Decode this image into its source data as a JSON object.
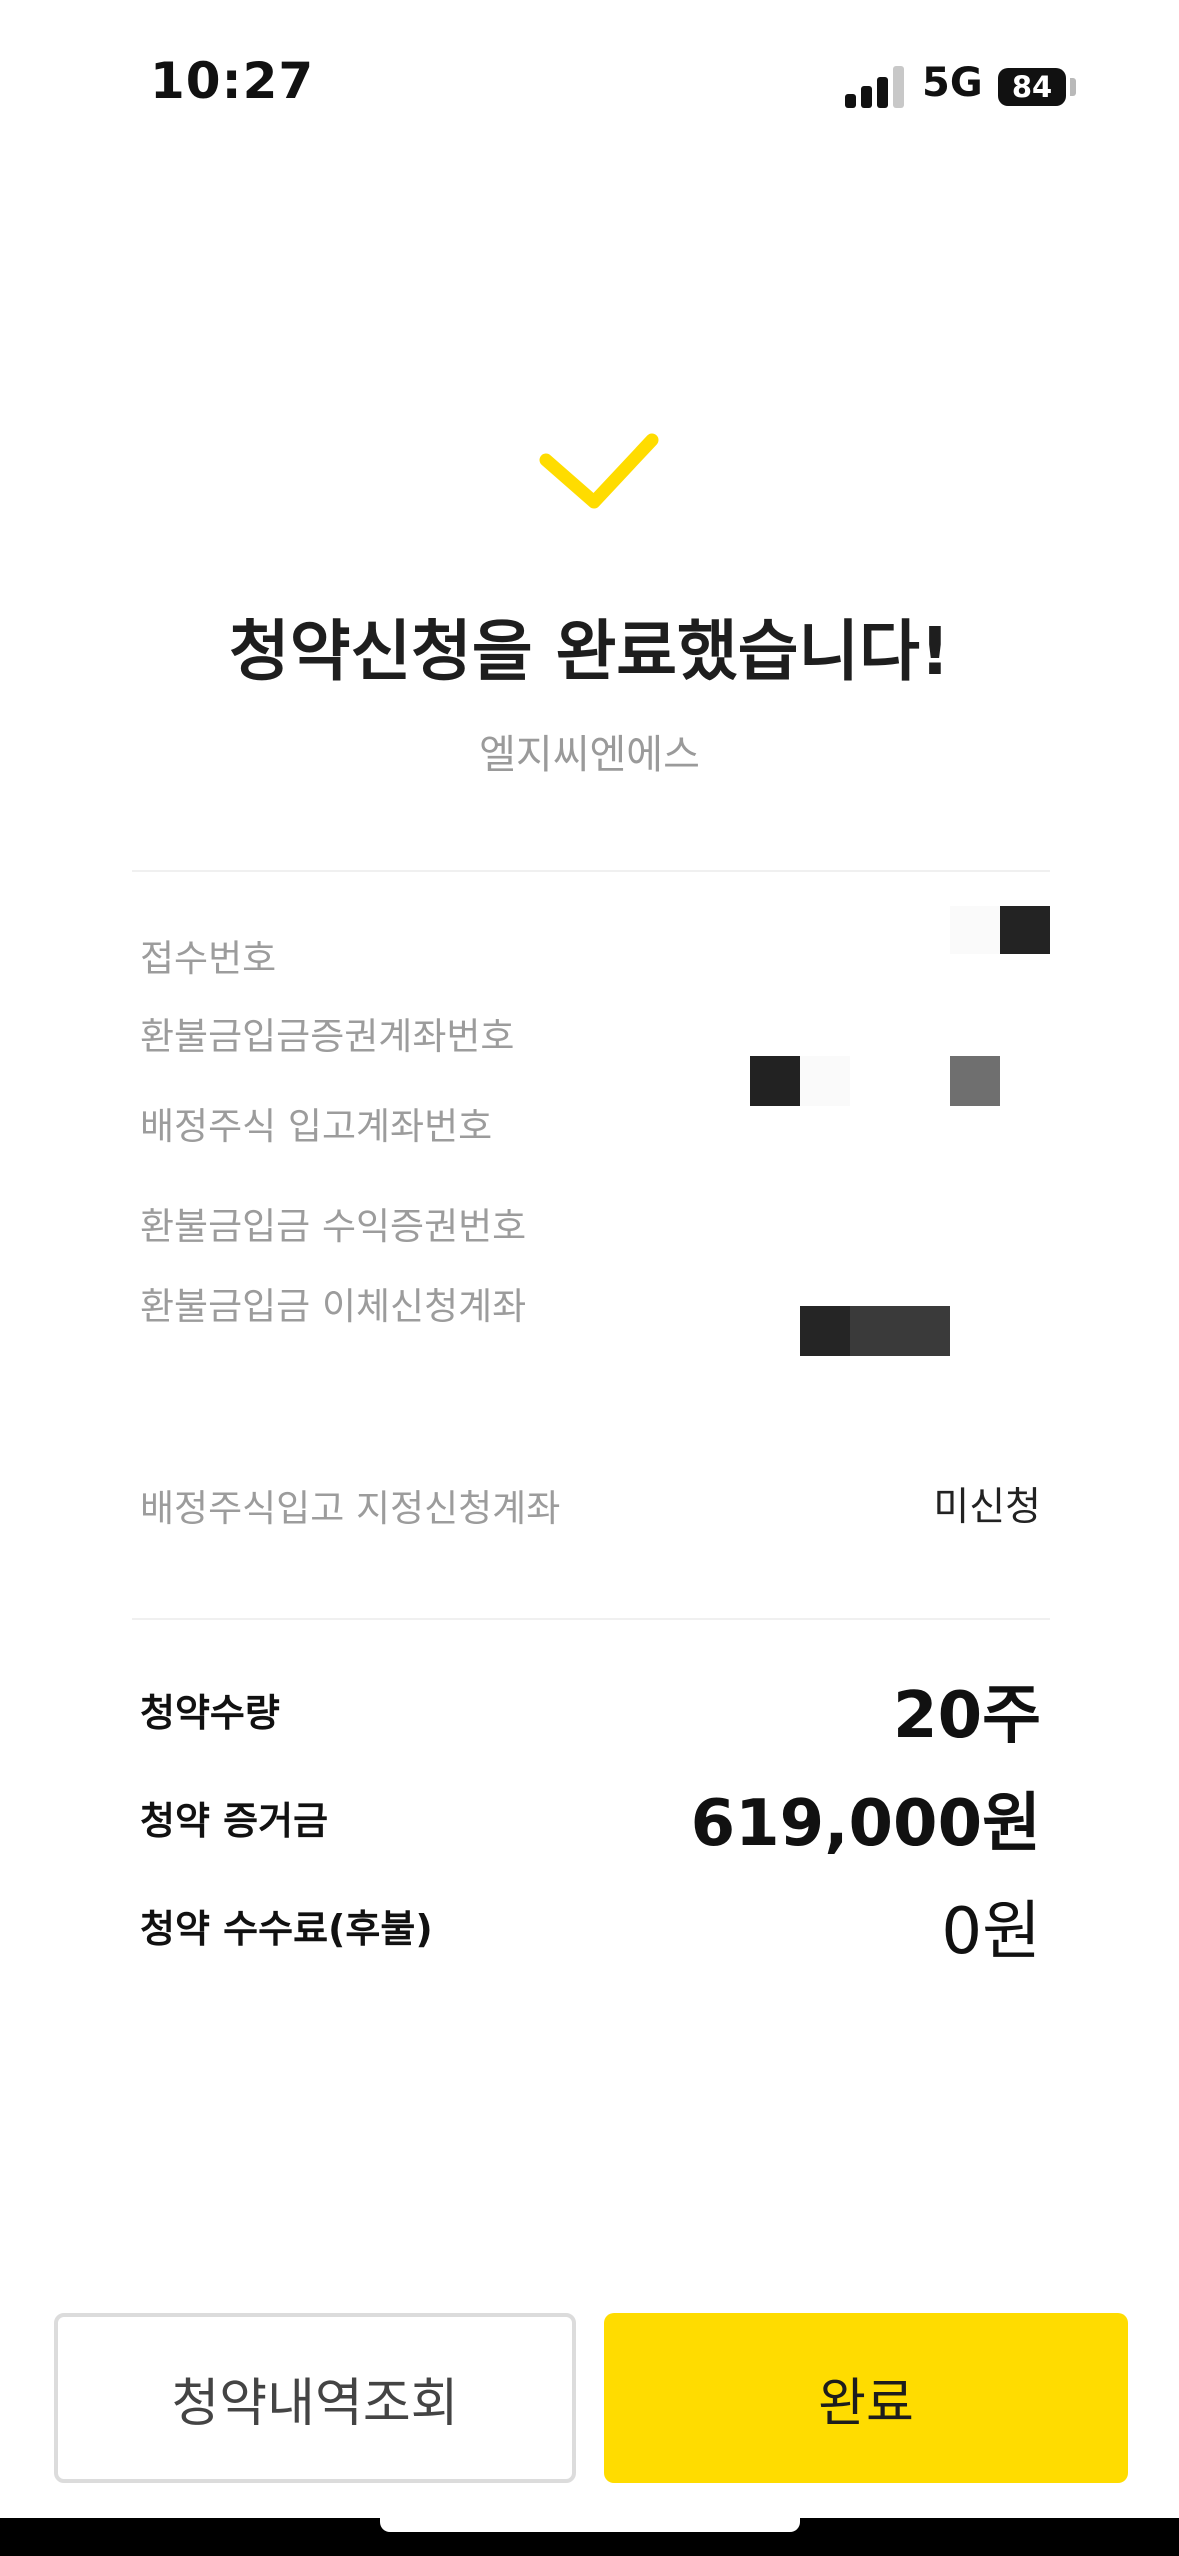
{
  "status": {
    "time": "10:27",
    "network": "5G",
    "battery": "84"
  },
  "result": {
    "title": "청약신청을 완료했습니다!",
    "company": "엘지씨엔에스"
  },
  "details": {
    "receipt_no_label": "접수번호",
    "refund_account_label": "환불금입금증권계좌번호",
    "allotment_account_label": "배정주식 입고계좌번호",
    "refund_profit_label": "환불금입금 수익증권번호",
    "refund_transfer_label": "환불금입금 이체신청계좌",
    "designated_account_label": "배정주식입고 지정신청계좌",
    "designated_account_value": "미신청"
  },
  "summary": {
    "quantity_label": "청약수량",
    "quantity_value": "20주",
    "deposit_label": "청약 증거금",
    "deposit_value": "619,000원",
    "fee_label": "청약 수수료(후불)",
    "fee_value": "0원"
  },
  "buttons": {
    "history": "청약내역조회",
    "done": "완료"
  },
  "colors": {
    "accent": "#FFDC00"
  }
}
